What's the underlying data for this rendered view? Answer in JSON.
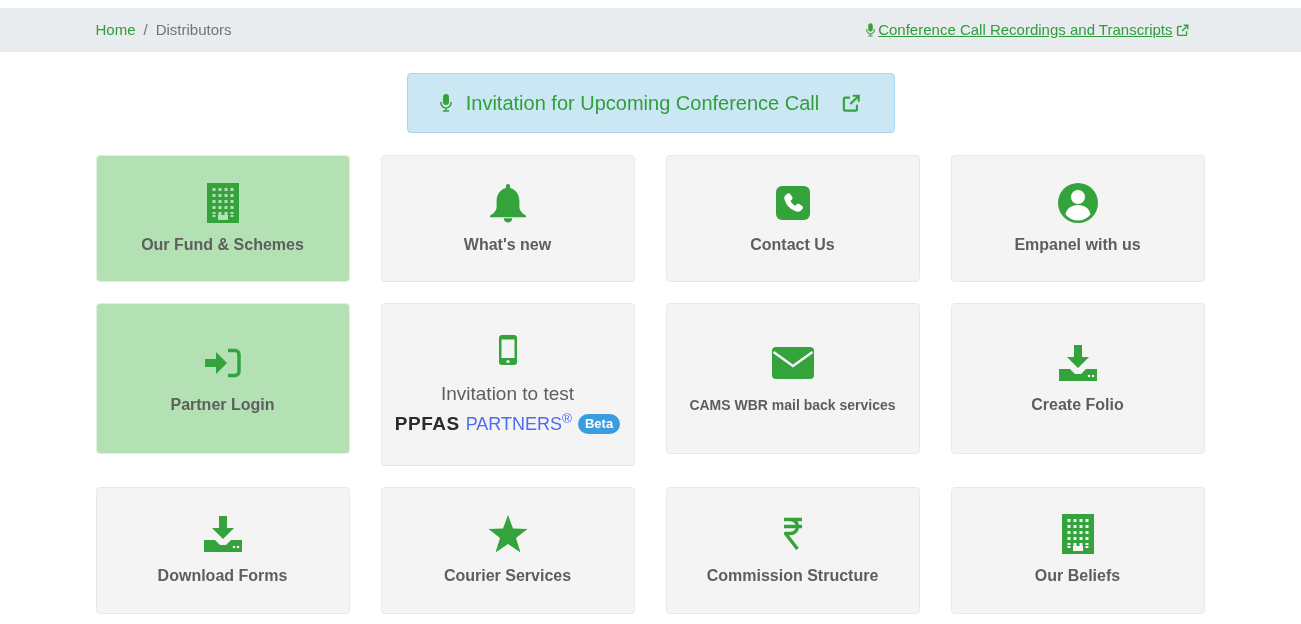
{
  "breadcrumb": {
    "items": [
      {
        "label": "Home",
        "current": false
      },
      {
        "label": "Distributors",
        "current": true
      }
    ],
    "separator": "/"
  },
  "recordings_link": {
    "label": "Conference Call Recordings and Transcripts"
  },
  "invite_button": {
    "label": "Invitation for Upcoming Conference Call"
  },
  "tile_rows": [
    [
      {
        "kind": "standard",
        "label": "Our Fund & Schemes",
        "selected": true
      },
      {
        "kind": "standard",
        "label": "What's new",
        "selected": false
      },
      {
        "kind": "standard",
        "label": "Contact Us",
        "selected": false
      },
      {
        "kind": "standard",
        "label": "Empanel with us",
        "selected": false
      }
    ],
    [
      {
        "kind": "standard",
        "label": "Partner Login",
        "selected": true
      },
      {
        "kind": "promo",
        "label": "Invitation to test",
        "logo": {
          "wordmark": "PPFAS",
          "product": "PARTNERS$^{®}$"
        },
        "badge": "Beta",
        "selected": false
      },
      {
        "kind": "compact",
        "label": "CAMS WBR mail back services",
        "selected": false
      },
      {
        "kind": "standard",
        "label": "Create Folio",
        "selected": false
      }
    ],
    [
      {
        "kind": "standard",
        "label": "Download Forms",
        "selected": false
      },
      {
        "kind": "standard",
        "label": "Courier Services",
        "selected": false
      },
      {
        "kind": "standard",
        "label": "Commission Structure",
        "selected": false
      },
      {
        "kind": "standard",
        "label": "Our Beliefs",
        "selected": false
      }
    ]
  ]
}
